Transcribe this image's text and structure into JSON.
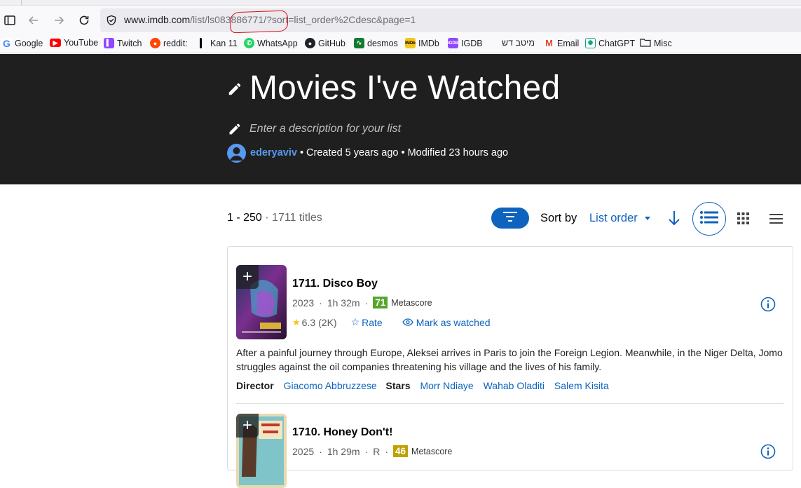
{
  "browser": {
    "url_domain": "www.imdb.com",
    "url_path": "/list/ls083886771/?sort=list_order%2Cdesc&page=1",
    "bookmarks": [
      {
        "label": "Google",
        "icon": "google-icon",
        "color": "#4285f4"
      },
      {
        "label": "YouTube",
        "icon": "youtube-icon",
        "color": "#ff0000"
      },
      {
        "label": "Twitch",
        "icon": "twitch-icon",
        "color": "#9146ff"
      },
      {
        "label": "reddit:",
        "icon": "reddit-icon",
        "color": "#ff4500"
      },
      {
        "label": "Kan 11",
        "icon": "kan-icon",
        "color": "#000000"
      },
      {
        "label": "WhatsApp",
        "icon": "whatsapp-icon",
        "color": "#25d366"
      },
      {
        "label": "GitHub",
        "icon": "github-icon",
        "color": "#1f2328"
      },
      {
        "label": "desmos",
        "icon": "desmos-icon",
        "color": "#127a31"
      },
      {
        "label": "IMDb",
        "icon": "imdb-icon",
        "color": "#f5c518"
      },
      {
        "label": "IGDB",
        "icon": "igdb-icon",
        "color": "#9147ff"
      },
      {
        "label": "מיטב דש",
        "icon": "meitav-icon",
        "color": "#ffffff"
      },
      {
        "label": "Email",
        "icon": "gmail-icon",
        "color": "#ea4335"
      },
      {
        "label": "ChatGPT",
        "icon": "chatgpt-icon",
        "color": "#10a37f"
      },
      {
        "label": "Misc",
        "icon": "folder-icon",
        "color": "#1c1b22"
      }
    ]
  },
  "list": {
    "title": "Movies I've Watched",
    "description_placeholder": "Enter a description for your list",
    "username": "ederyaviv",
    "created": "• Created 5 years ago",
    "modified": "• Modified 23 hours ago"
  },
  "toolbar": {
    "range": "1 - 250",
    "separator": "·",
    "total": "1711 titles",
    "sort_label": "Sort by",
    "sort_value": "List order"
  },
  "items": [
    {
      "title": "1711. Disco Boy",
      "year": "2023",
      "runtime": "1h 32m",
      "certificate": "",
      "metascore": "71",
      "metascore_color": "#54a72a",
      "metascore_label": "Metascore",
      "rating": "6.3",
      "votes": "(2K)",
      "rate_label": "Rate",
      "watched_label": "Mark as watched",
      "plot": "After a painful journey through Europe, Aleksei arrives in Paris to join the Foreign Legion. Meanwhile, in the Niger Delta, Jomo struggles against the oil companies threatening his village and the lives of his family.",
      "director_label": "Director",
      "director": "Giacomo Abbruzzese",
      "stars_label": "Stars",
      "stars": [
        "Morr Ndiaye",
        "Wahab Oladiti",
        "Salem Kisita"
      ]
    },
    {
      "title": "1710. Honey Don't!",
      "year": "2025",
      "runtime": "1h 29m",
      "certificate": "R",
      "metascore": "46",
      "metascore_color": "#c0a000",
      "metascore_label": "Metascore"
    }
  ]
}
